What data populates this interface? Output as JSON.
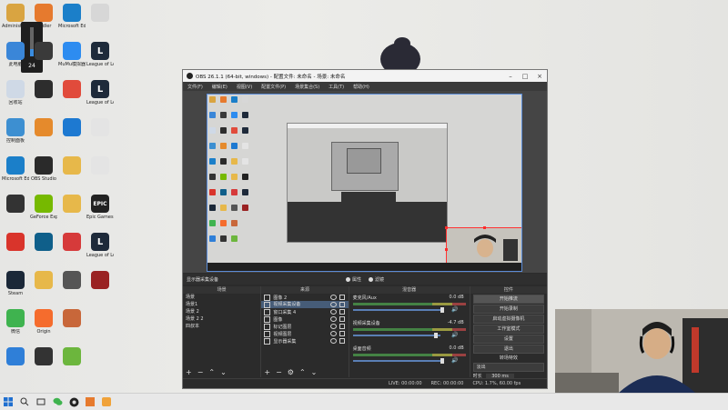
{
  "desktop": {
    "volume_value": "24",
    "icons": [
      {
        "label": "Administrator",
        "color": "#d9a441",
        "glyph": ""
      },
      {
        "label": "Fiddler",
        "color": "#e67a2e",
        "glyph": ""
      },
      {
        "label": "Microsoft Edge",
        "color": "#1b7fc9",
        "glyph": ""
      },
      {
        "label": "",
        "color": "#d7d7d7",
        "glyph": ""
      },
      {
        "label": "此电脑",
        "color": "#3a86d8",
        "glyph": ""
      },
      {
        "label": "",
        "color": "#3a3a3a",
        "glyph": ""
      },
      {
        "label": "MuMu模拟器",
        "color": "#2d8cf0",
        "glyph": ""
      },
      {
        "label": "League of Legends",
        "color": "#1e2a3a",
        "glyph": "L"
      },
      {
        "label": "回收站",
        "color": "#cfd9e6",
        "glyph": ""
      },
      {
        "label": "",
        "color": "#2d2d2d",
        "glyph": ""
      },
      {
        "label": "",
        "color": "#e14b3b",
        "glyph": ""
      },
      {
        "label": "League of Legends",
        "color": "#1e2a3a",
        "glyph": "L"
      },
      {
        "label": "控制面板",
        "color": "#3d8fd1",
        "glyph": ""
      },
      {
        "label": "",
        "color": "#e58a2c",
        "glyph": ""
      },
      {
        "label": "",
        "color": "#1d79d1",
        "glyph": ""
      },
      {
        "label": "",
        "color": "#e4e4e4",
        "glyph": ""
      },
      {
        "label": "Microsoft Edge",
        "color": "#1b7fc9",
        "glyph": ""
      },
      {
        "label": "OBS Studio",
        "color": "#2a2a2a",
        "glyph": ""
      },
      {
        "label": "",
        "color": "#e7b84a",
        "glyph": ""
      },
      {
        "label": "",
        "color": "#e4e4e4",
        "glyph": ""
      },
      {
        "label": "",
        "color": "#333333",
        "glyph": ""
      },
      {
        "label": "GeForce Experience",
        "color": "#76b900",
        "glyph": ""
      },
      {
        "label": "",
        "color": "#e7b84a",
        "glyph": ""
      },
      {
        "label": "Epic Games Launcher",
        "color": "#222222",
        "glyph": "EPIC"
      },
      {
        "label": "",
        "color": "#d9342b",
        "glyph": ""
      },
      {
        "label": "",
        "color": "#0f5f8a",
        "glyph": ""
      },
      {
        "label": "",
        "color": "#d63a3a",
        "glyph": ""
      },
      {
        "label": "League of Legends",
        "color": "#1e2a3a",
        "glyph": "L"
      },
      {
        "label": "Steam",
        "color": "#1b2838",
        "glyph": ""
      },
      {
        "label": "",
        "color": "#e7b84a",
        "glyph": ""
      },
      {
        "label": "",
        "color": "#555555",
        "glyph": ""
      },
      {
        "label": "",
        "color": "#9a2222",
        "glyph": ""
      },
      {
        "label": "微信",
        "color": "#3fb34f",
        "glyph": ""
      },
      {
        "label": "Origin",
        "color": "#f56c2d",
        "glyph": ""
      },
      {
        "label": "",
        "color": "#c8673a",
        "glyph": ""
      },
      {
        "label": "",
        "color": "",
        "glyph": ""
      },
      {
        "label": "",
        "color": "#2f7fd8",
        "glyph": ""
      },
      {
        "label": "",
        "color": "#333333",
        "glyph": ""
      },
      {
        "label": "",
        "color": "#6cb63d",
        "glyph": ""
      },
      {
        "label": "",
        "color": "",
        "glyph": ""
      }
    ]
  },
  "obs": {
    "title": "OBS 26.1.1 (64-bit, windows) - 配置文件: 未命名 - 场景: 未命名",
    "menu": [
      "文件(F)",
      "编辑(E)",
      "视图(V)",
      "配置文件(P)",
      "场景集合(S)",
      "工具(T)",
      "帮助(H)"
    ],
    "source_label": "显示器采集设备",
    "props_label": "属性",
    "filters_label": "滤镜",
    "studio_mode_label": "工作室模式",
    "docks": {
      "scenes_header": "场景",
      "sources_header": "来源",
      "mixer_header": "混音器",
      "controls_header": "控件"
    },
    "scenes": [
      "场景",
      "场景1",
      "场景 2",
      "场景 2 2",
      "四叔本"
    ],
    "sources": [
      "图像 2",
      "视频采集设备",
      "窗口采集 4",
      "图像",
      "标记图层",
      "视频图层",
      "显示器采集"
    ],
    "mixer": [
      {
        "name": "麦克风/Aux",
        "db": "0.0 dB",
        "level": 0.78
      },
      {
        "name": "视频采集设备",
        "db": "-4.7 dB",
        "level": 0.72
      },
      {
        "name": "桌面音频",
        "db": "0.0 dB",
        "level": 0.78
      }
    ],
    "controls": [
      "开始推流",
      "开始录制",
      "启动虚拟摄像机",
      "工作室模式",
      "设置",
      "退出"
    ],
    "transition": {
      "label": "转场特效",
      "value": "淡出",
      "duration_label": "时长",
      "duration": "300 ms"
    },
    "status": {
      "live": "LIVE: 00:00:00",
      "rec": "REC: 00:00:00",
      "cpu": "CPU: 1.7%, 60.00 fps"
    }
  },
  "taskbar": {
    "icons": [
      "windows-start-icon",
      "search-icon",
      "task-view-icon",
      "wechat-icon",
      "obs-icon",
      "tiles-icon",
      "fiddler-icon"
    ]
  }
}
